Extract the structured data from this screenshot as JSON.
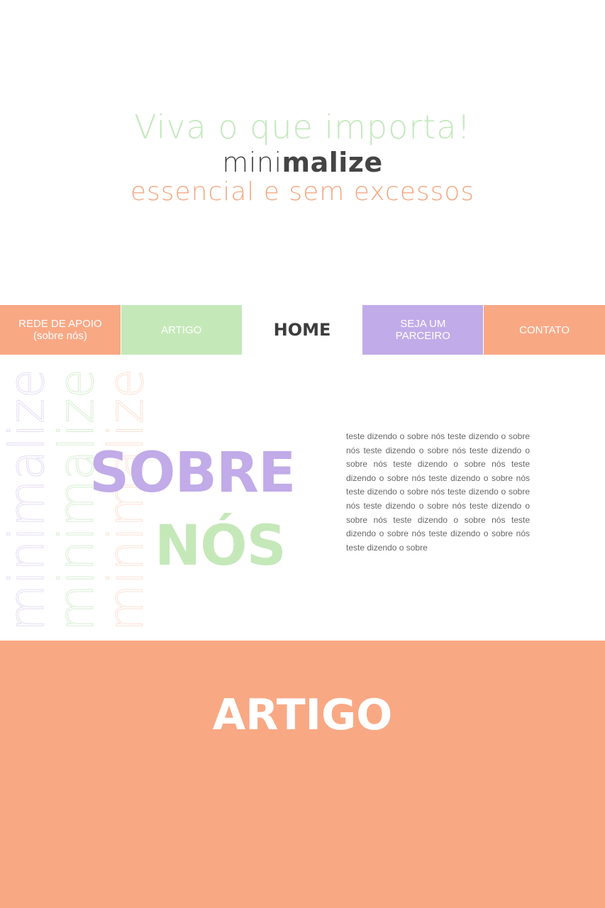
{
  "hero": {
    "tagline": "Viva o que importa!",
    "brand_light": "mini",
    "brand_bold": "malize",
    "subtitle": "essencial e sem excessos"
  },
  "nav": {
    "items": [
      {
        "label": "REDE DE APOIO\n(sobre nós)"
      },
      {
        "label": "ARTIGO"
      },
      {
        "label": "HOME"
      },
      {
        "label": "SEJA UM\nPARCEIRO"
      },
      {
        "label": "CONTATO"
      }
    ]
  },
  "about": {
    "watermark": "minimalize",
    "heading_line1": "SOBRE",
    "heading_line2": "NÓS",
    "body": "teste dizendo o sobre nós teste dizendo o sobre nós teste dizendo o sobre nós teste dizendo o sobre nós teste dizendo o sobre nós teste dizendo o sobre nós teste dizendo o sobre nós teste dizendo o sobre nós teste dizendo o sobre nós teste dizendo o sobre nós teste dizendo o sobre nós teste dizendo o sobre nós teste dizendo o sobre nós teste dizendo o sobre nós teste dizendo o sobre"
  },
  "article": {
    "title": "ARTIGO"
  },
  "colors": {
    "peach": "#f9a884",
    "green": "#c5e8b9",
    "lavender": "#c1abe8",
    "dark": "#444444"
  }
}
